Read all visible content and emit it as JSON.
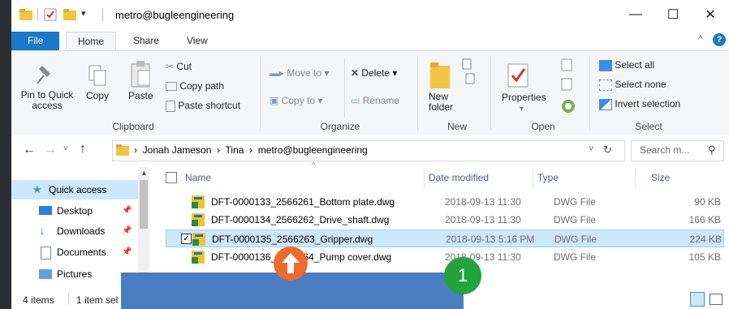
{
  "window": {
    "title": "metro@bugleengineering",
    "controls": {
      "minimize": "—",
      "maximize": "☐",
      "close": "✕"
    }
  },
  "ribbon_tabs": [
    "File",
    "Home",
    "Share",
    "View"
  ],
  "ribbon": {
    "clipboard": {
      "group": "Clipboard",
      "pin_label_1": "Pin to Quick",
      "pin_label_2": "access",
      "copy": "Copy",
      "paste": "Paste",
      "cut": "Cut",
      "copy_path": "Copy path",
      "paste_shortcut": "Paste shortcut"
    },
    "organize": {
      "group": "Organize",
      "move_to": "Move to",
      "copy_to": "Copy to",
      "delete": "Delete",
      "rename": "Rename"
    },
    "new": {
      "group": "New",
      "new_folder_1": "New",
      "new_folder_2": "folder"
    },
    "open": {
      "group": "Open",
      "properties": "Properties"
    },
    "select": {
      "group": "Select",
      "select_all": "Select all",
      "select_none": "Select none",
      "invert_selection": "Invert selection"
    }
  },
  "address": {
    "crumbs": [
      "Jonah Jameson",
      "Tina",
      "metro@bugleengineering"
    ],
    "search_placeholder": "Search m..."
  },
  "nav": {
    "items": [
      {
        "label": "Quick access",
        "icon": "star-icon"
      },
      {
        "label": "Desktop",
        "icon": "desktop-icon"
      },
      {
        "label": "Downloads",
        "icon": "download-icon"
      },
      {
        "label": "Documents",
        "icon": "document-icon"
      },
      {
        "label": "Pictures",
        "icon": "pictures-icon"
      }
    ]
  },
  "list": {
    "headers": {
      "name": "Name",
      "date": "Date modified",
      "type": "Type",
      "size": "Size"
    },
    "rows": [
      {
        "name": "DFT-0000133_2566261_Bottom plate.dwg",
        "date": "2018-09-13 11:30",
        "type": "DWG File",
        "size": "90 KB"
      },
      {
        "name": "DFT-0000134_2566262_Drive_shaft.dwg",
        "date": "2018-09-13 11:30",
        "type": "DWG File",
        "size": "166 KB"
      },
      {
        "name": "DFT-0000135_2566263_Gripper.dwg",
        "date": "2018-09-13 5:16 PM",
        "type": "DWG File",
        "size": "224 KB"
      },
      {
        "name": "DFT-0000136_2566264_Pump cover.dwg",
        "date": "2018-09-13 11:30",
        "type": "DWG File",
        "size": "105 KB"
      }
    ]
  },
  "status": {
    "count": "4 items",
    "selected": "1 item sel"
  },
  "overlay": {
    "step_number": "1",
    "colors": {
      "blue_box": "#4a7dc1",
      "up_badge": "#ef6a2a",
      "step_badge": "#22a33b",
      "accent": "#1979ca"
    }
  }
}
